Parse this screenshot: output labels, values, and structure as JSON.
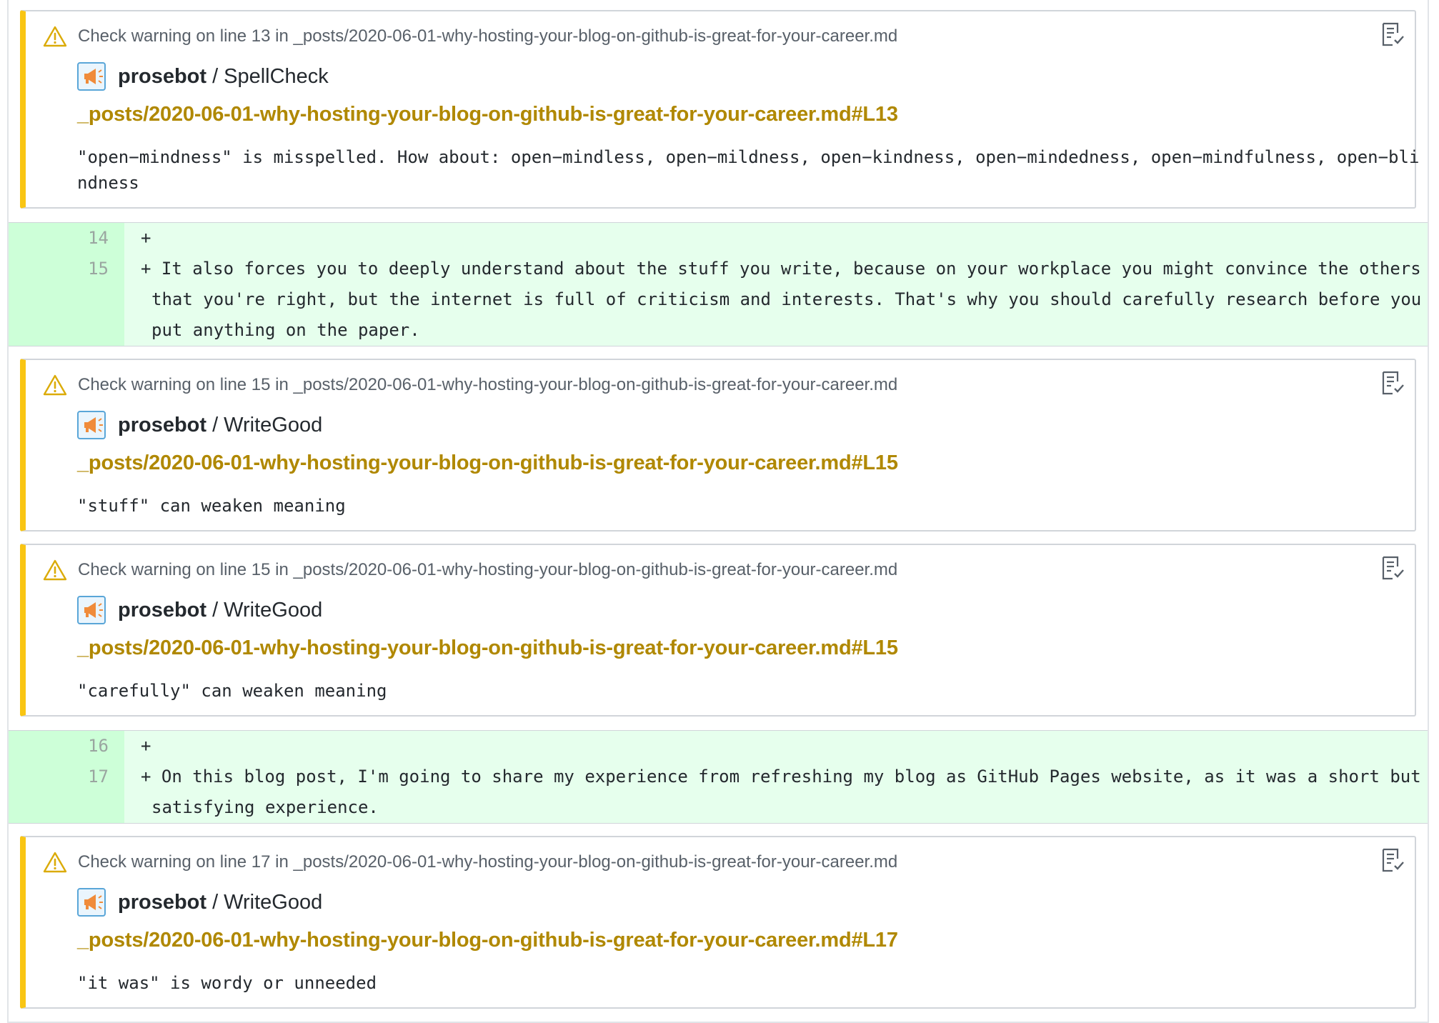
{
  "annotations": [
    {
      "header": "Check warning on line 13 in _posts/2020-06-01-why-hosting-your-blog-on-github-is-great-for-your-career.md",
      "app": "prosebot",
      "separator": "/",
      "check": "SpellCheck",
      "link": "_posts/2020-06-01-why-hosting-your-blog-on-github-is-great-for-your-career.md#L13",
      "message": "\"open−mindness\" is misspelled. How about: open−mindless, open−mildness, open−kindness, open−mindedness, open−mindfulness, open−blindness"
    },
    {
      "header": "Check warning on line 15 in _posts/2020-06-01-why-hosting-your-blog-on-github-is-great-for-your-career.md",
      "app": "prosebot",
      "separator": "/",
      "check": "WriteGood",
      "link": "_posts/2020-06-01-why-hosting-your-blog-on-github-is-great-for-your-career.md#L15",
      "message": "\"stuff\" can weaken meaning"
    },
    {
      "header": "Check warning on line 15 in _posts/2020-06-01-why-hosting-your-blog-on-github-is-great-for-your-career.md",
      "app": "prosebot",
      "separator": "/",
      "check": "WriteGood",
      "link": "_posts/2020-06-01-why-hosting-your-blog-on-github-is-great-for-your-career.md#L15",
      "message": "\"carefully\" can weaken meaning"
    },
    {
      "header": "Check warning on line 17 in _posts/2020-06-01-why-hosting-your-blog-on-github-is-great-for-your-career.md",
      "app": "prosebot",
      "separator": "/",
      "check": "WriteGood",
      "link": "_posts/2020-06-01-why-hosting-your-blog-on-github-is-great-for-your-career.md#L17",
      "message": "\"it was\" is wordy or unneeded"
    }
  ],
  "diffs": [
    {
      "lines": [
        {
          "num": "14",
          "code": "+"
        },
        {
          "num": "15",
          "code": "+ It also forces you to deeply understand about the stuff you write, because on your workplace you might convince the others that you're right, but the internet is full of criticism and interests. That's why you should carefully research before you put anything on the paper."
        }
      ]
    },
    {
      "lines": [
        {
          "num": "16",
          "code": "+"
        },
        {
          "num": "17",
          "code": "+ On this blog post, I'm going to share my experience from refreshing my blog as GitHub Pages website, as it was a short but satisfying experience."
        }
      ]
    }
  ],
  "colors": {
    "warning_bar": "#f9c513",
    "link": "#b08800",
    "diff_added_bg": "#e6ffed",
    "diff_added_gutter": "#cdffd8"
  },
  "icons": {
    "warning": "alert-triangle-icon",
    "file_check": "file-check-icon",
    "app_avatar": "megaphone-icon"
  }
}
